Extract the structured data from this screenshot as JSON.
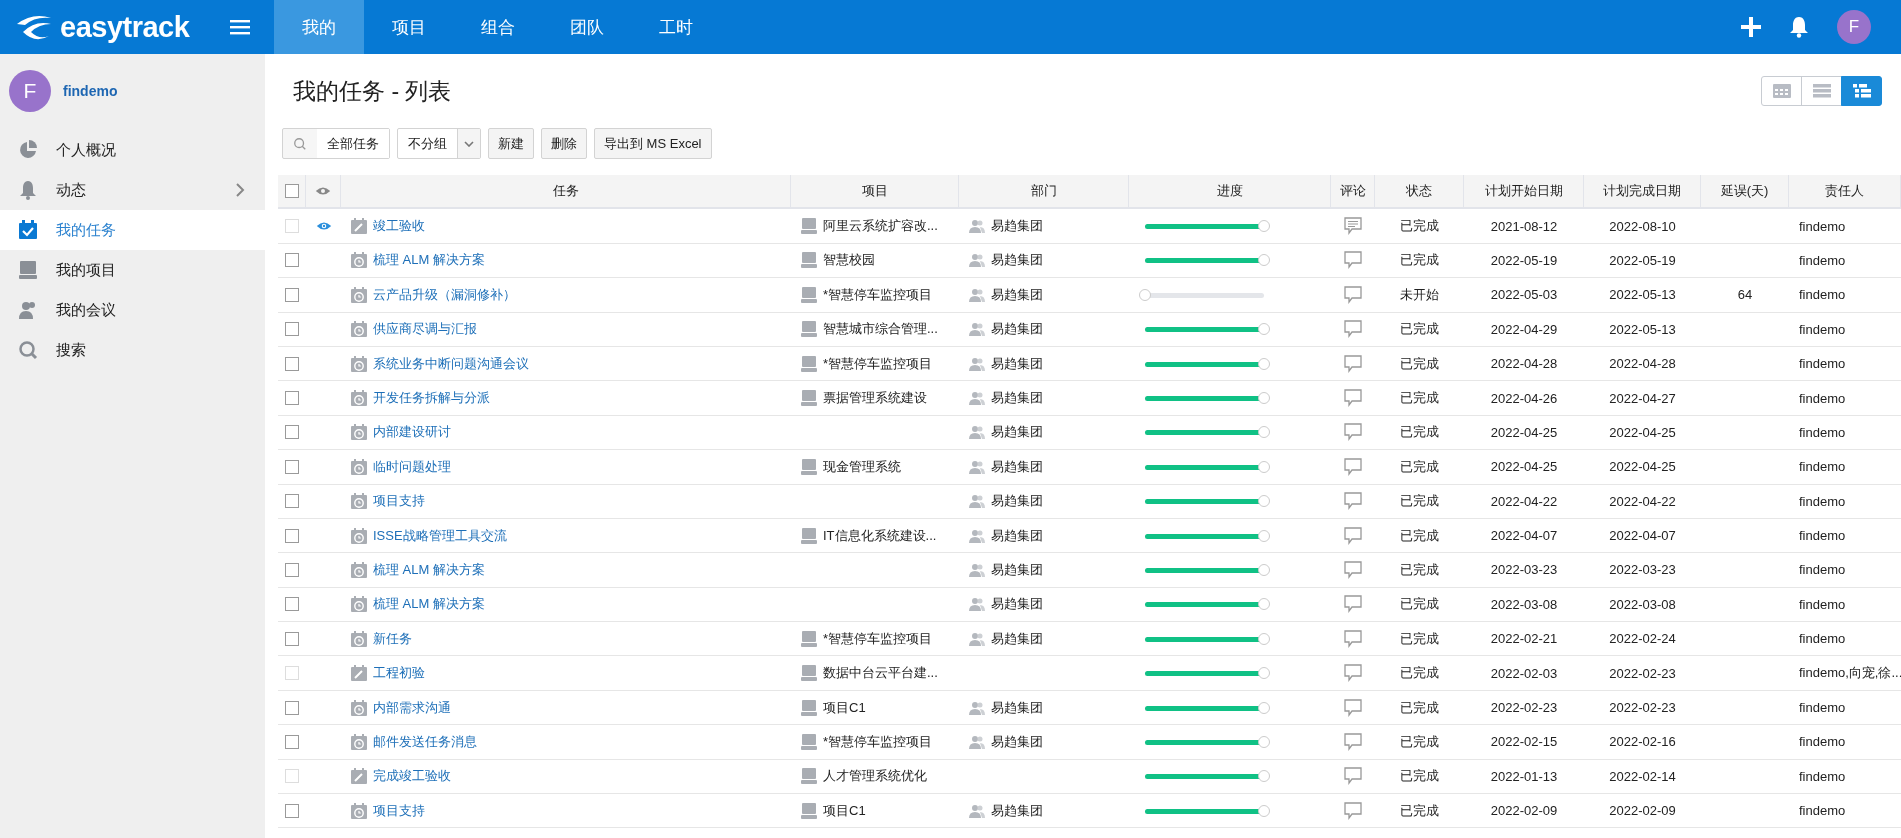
{
  "brand": {
    "name": "easytrack"
  },
  "nav": [
    {
      "label": "我的",
      "selected": true
    },
    {
      "label": "项目",
      "selected": false
    },
    {
      "label": "组合",
      "selected": false
    },
    {
      "label": "团队",
      "selected": false
    },
    {
      "label": "工时",
      "selected": false
    }
  ],
  "header_avatar": "F",
  "user": {
    "initial": "F",
    "name": "findemo"
  },
  "sidebar": {
    "items": [
      {
        "kind": "overview",
        "label": "个人概况",
        "selected": false,
        "expandable": false
      },
      {
        "kind": "activity",
        "label": "动态",
        "selected": false,
        "expandable": true
      },
      {
        "kind": "tasks",
        "label": "我的任务",
        "selected": true,
        "expandable": false
      },
      {
        "kind": "projects",
        "label": "我的项目",
        "selected": false,
        "expandable": false
      },
      {
        "kind": "meetings",
        "label": "我的会议",
        "selected": false,
        "expandable": false
      },
      {
        "kind": "search",
        "label": "搜索",
        "selected": false,
        "expandable": false
      }
    ]
  },
  "page_title": "我的任务 - 列表",
  "view_toggles": [
    {
      "kind": "calendar",
      "selected": false
    },
    {
      "kind": "rows",
      "selected": false
    },
    {
      "kind": "list",
      "selected": true
    }
  ],
  "toolbar": {
    "filter": "全部任务",
    "group": "不分组",
    "buttons": [
      "新建",
      "删除",
      "导出到 MS Excel"
    ]
  },
  "table": {
    "columns": [
      "任务",
      "项目",
      "部门",
      "进度",
      "评论",
      "状态",
      "计划开始日期",
      "计划完成日期",
      "延误(天)",
      "责任人"
    ],
    "select_all_checked": false,
    "rows": [
      {
        "kind": "note",
        "checked": false,
        "disabled": true,
        "watched": true,
        "task": "竣工验收",
        "project": "阿里云系统扩容改...",
        "dept": "易趋集团",
        "level": 1,
        "has_comments": true,
        "status": "已完成",
        "start": "2021-08-12",
        "end": "2022-08-10",
        "delay": "",
        "owner": "findemo"
      },
      {
        "kind": "meeting",
        "checked": false,
        "disabled": false,
        "watched": false,
        "task": "梳理 ALM 解决方案",
        "project": "智慧校园",
        "dept": "易趋集团",
        "level": 1,
        "has_comments": false,
        "status": "已完成",
        "start": "2022-05-19",
        "end": "2022-05-19",
        "delay": "",
        "owner": "findemo"
      },
      {
        "kind": "meeting",
        "checked": false,
        "disabled": false,
        "watched": false,
        "task": "云产品升级（漏洞修补）",
        "project": "*智慧停车监控项目",
        "dept": "易趋集团",
        "level": 0,
        "has_comments": false,
        "status": "未开始",
        "start": "2022-05-03",
        "end": "2022-05-13",
        "delay": "64",
        "owner": "findemo"
      },
      {
        "kind": "meeting",
        "checked": false,
        "disabled": false,
        "watched": false,
        "task": "供应商尽调与汇报",
        "project": "智慧城市综合管理...",
        "dept": "易趋集团",
        "level": 1,
        "has_comments": false,
        "status": "已完成",
        "start": "2022-04-29",
        "end": "2022-05-13",
        "delay": "",
        "owner": "findemo"
      },
      {
        "kind": "meeting",
        "checked": false,
        "disabled": false,
        "watched": false,
        "task": "系统业务中断问题沟通会议",
        "project": "*智慧停车监控项目",
        "dept": "易趋集团",
        "level": 1,
        "has_comments": false,
        "status": "已完成",
        "start": "2022-04-28",
        "end": "2022-04-28",
        "delay": "",
        "owner": "findemo"
      },
      {
        "kind": "meeting",
        "checked": false,
        "disabled": false,
        "watched": false,
        "task": "开发任务拆解与分派",
        "project": "票据管理系统建设",
        "dept": "易趋集团",
        "level": 1,
        "has_comments": false,
        "status": "已完成",
        "start": "2022-04-26",
        "end": "2022-04-27",
        "delay": "",
        "owner": "findemo"
      },
      {
        "kind": "meeting",
        "checked": false,
        "disabled": false,
        "watched": false,
        "task": "内部建设研讨",
        "project": "",
        "dept": "易趋集团",
        "level": 1,
        "has_comments": false,
        "status": "已完成",
        "start": "2022-04-25",
        "end": "2022-04-25",
        "delay": "",
        "owner": "findemo"
      },
      {
        "kind": "meeting",
        "checked": false,
        "disabled": false,
        "watched": false,
        "task": "临时问题处理",
        "project": "现金管理系统",
        "dept": "易趋集团",
        "level": 1,
        "has_comments": false,
        "status": "已完成",
        "start": "2022-04-25",
        "end": "2022-04-25",
        "delay": "",
        "owner": "findemo"
      },
      {
        "kind": "meeting",
        "checked": false,
        "disabled": false,
        "watched": false,
        "task": "项目支持",
        "project": "",
        "dept": "易趋集团",
        "level": 1,
        "has_comments": false,
        "status": "已完成",
        "start": "2022-04-22",
        "end": "2022-04-22",
        "delay": "",
        "owner": "findemo"
      },
      {
        "kind": "meeting",
        "checked": false,
        "disabled": false,
        "watched": false,
        "task": "ISSE战略管理工具交流",
        "project": "IT信息化系统建设...",
        "dept": "易趋集团",
        "level": 1,
        "has_comments": false,
        "status": "已完成",
        "start": "2022-04-07",
        "end": "2022-04-07",
        "delay": "",
        "owner": "findemo"
      },
      {
        "kind": "meeting",
        "checked": false,
        "disabled": false,
        "watched": false,
        "task": "梳理 ALM 解决方案",
        "project": "",
        "dept": "易趋集团",
        "level": 1,
        "has_comments": false,
        "status": "已完成",
        "start": "2022-03-23",
        "end": "2022-03-23",
        "delay": "",
        "owner": "findemo"
      },
      {
        "kind": "meeting",
        "checked": false,
        "disabled": false,
        "watched": false,
        "task": "梳理 ALM 解决方案",
        "project": "",
        "dept": "易趋集团",
        "level": 1,
        "has_comments": false,
        "status": "已完成",
        "start": "2022-03-08",
        "end": "2022-03-08",
        "delay": "",
        "owner": "findemo"
      },
      {
        "kind": "meeting",
        "checked": false,
        "disabled": false,
        "watched": false,
        "task": "新任务",
        "project": "*智慧停车监控项目",
        "dept": "易趋集团",
        "level": 1,
        "has_comments": false,
        "status": "已完成",
        "start": "2022-02-21",
        "end": "2022-02-24",
        "delay": "",
        "owner": "findemo"
      },
      {
        "kind": "note",
        "checked": false,
        "disabled": true,
        "watched": false,
        "task": "工程初验",
        "project": "数据中台云平台建...",
        "dept": "",
        "level": 1,
        "has_comments": false,
        "status": "已完成",
        "start": "2022-02-03",
        "end": "2022-02-23",
        "delay": "",
        "owner": "findemo,向宠,徐..."
      },
      {
        "kind": "meeting",
        "checked": false,
        "disabled": false,
        "watched": false,
        "task": "内部需求沟通",
        "project": "项目C1",
        "dept": "易趋集团",
        "level": 1,
        "has_comments": false,
        "status": "已完成",
        "start": "2022-02-23",
        "end": "2022-02-23",
        "delay": "",
        "owner": "findemo"
      },
      {
        "kind": "meeting",
        "checked": false,
        "disabled": false,
        "watched": false,
        "task": "邮件发送任务消息",
        "project": "*智慧停车监控项目",
        "dept": "易趋集团",
        "level": 1,
        "has_comments": false,
        "status": "已完成",
        "start": "2022-02-15",
        "end": "2022-02-16",
        "delay": "",
        "owner": "findemo"
      },
      {
        "kind": "note",
        "checked": false,
        "disabled": true,
        "watched": false,
        "task": "完成竣工验收",
        "project": "人才管理系统优化",
        "dept": "",
        "level": 1,
        "has_comments": false,
        "status": "已完成",
        "start": "2022-01-13",
        "end": "2022-02-14",
        "delay": "",
        "owner": "findemo"
      },
      {
        "kind": "meeting",
        "checked": false,
        "disabled": false,
        "watched": false,
        "task": "项目支持",
        "project": "项目C1",
        "dept": "易趋集团",
        "level": 1,
        "has_comments": false,
        "status": "已完成",
        "start": "2022-02-09",
        "end": "2022-02-09",
        "delay": "",
        "owner": "findemo"
      }
    ]
  }
}
